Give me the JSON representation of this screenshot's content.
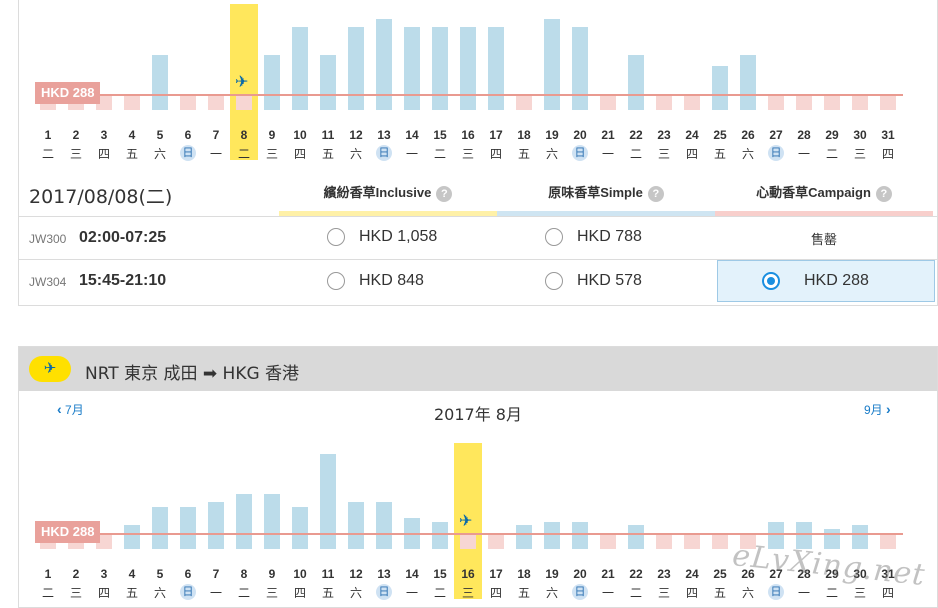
{
  "colors": {
    "bar": "#bcdcea",
    "bar_dim": "#f7d6d3",
    "highlight": "#ffe75c",
    "ref_line": "#e99a90",
    "accent": "#1a8fe0",
    "inclusive": "#fff1a8",
    "simple": "#cfe5f2",
    "campaign": "#f8cfcc"
  },
  "panel1": {
    "price_tag": "HKD 288",
    "selected_day_index": 7,
    "days": [
      "1",
      "2",
      "3",
      "4",
      "5",
      "6",
      "7",
      "8",
      "9",
      "10",
      "11",
      "12",
      "13",
      "14",
      "15",
      "16",
      "17",
      "18",
      "19",
      "20",
      "21",
      "22",
      "23",
      "24",
      "25",
      "26",
      "27",
      "28",
      "29",
      "30",
      "31"
    ],
    "weekdays": [
      "二",
      "三",
      "四",
      "五",
      "六",
      "日",
      "一",
      "二",
      "三",
      "四",
      "五",
      "六",
      "日",
      "一",
      "二",
      "三",
      "四",
      "五",
      "六",
      "日",
      "一",
      "二",
      "三",
      "四",
      "五",
      "六",
      "日",
      "一",
      "二",
      "三",
      "四"
    ],
    "chart_data": {
      "type": "bar",
      "categories": [
        "1",
        "2",
        "3",
        "4",
        "5",
        "6",
        "7",
        "8",
        "9",
        "10",
        "11",
        "12",
        "13",
        "14",
        "15",
        "16",
        "17",
        "18",
        "19",
        "20",
        "21",
        "22",
        "23",
        "24",
        "25",
        "26",
        "27",
        "28",
        "29",
        "30",
        "31"
      ],
      "values": [
        288,
        288,
        288,
        288,
        578,
        288,
        288,
        288,
        578,
        788,
        578,
        788,
        848,
        788,
        788,
        788,
        788,
        288,
        848,
        788,
        288,
        578,
        288,
        288,
        498,
        578,
        288,
        288,
        288,
        288,
        288
      ],
      "highlight": "8",
      "reference_line": 288
    }
  },
  "fare_table": {
    "date": "2017/08/08(二)",
    "headers": [
      {
        "label": "繽紛香草Inclusive",
        "help": "?"
      },
      {
        "label": "原味香草Simple",
        "help": "?"
      },
      {
        "label": "心動香草Campaign",
        "help": "?"
      }
    ],
    "rows": [
      {
        "flight": "JW300",
        "time": "02:00-07:25",
        "inclusive": "HKD 1,058",
        "simple": "HKD 788",
        "campaign": "售罄"
      },
      {
        "flight": "JW304",
        "time": "15:45-21:10",
        "inclusive": "HKD 848",
        "simple": "HKD 578",
        "campaign": "HKD 288"
      }
    ]
  },
  "panel2": {
    "route": "NRT 東京 成田 ➡ HKG 香港",
    "plane_icon": "plane-icon",
    "prev_month": "7月",
    "next_month": "9月",
    "month_title": "2017年 8月",
    "price_tag": "HKD 288",
    "selected_day_index": 15,
    "days": [
      "1",
      "2",
      "3",
      "4",
      "5",
      "6",
      "7",
      "8",
      "9",
      "10",
      "11",
      "12",
      "13",
      "14",
      "15",
      "16",
      "17",
      "18",
      "19",
      "20",
      "21",
      "22",
      "23",
      "24",
      "25",
      "26",
      "27",
      "28",
      "29",
      "30",
      "31"
    ],
    "weekdays": [
      "二",
      "三",
      "四",
      "五",
      "六",
      "日",
      "一",
      "二",
      "三",
      "四",
      "五",
      "六",
      "日",
      "一",
      "二",
      "三",
      "四",
      "五",
      "六",
      "日",
      "一",
      "二",
      "三",
      "四",
      "五",
      "六",
      "日",
      "一",
      "二",
      "三",
      "四"
    ],
    "chart_data": {
      "type": "bar",
      "categories": [
        "1",
        "2",
        "3",
        "4",
        "5",
        "6",
        "7",
        "8",
        "9",
        "10",
        "11",
        "12",
        "13",
        "14",
        "15",
        "16",
        "17",
        "18",
        "19",
        "20",
        "21",
        "22",
        "23",
        "24",
        "25",
        "26",
        "27",
        "28",
        "29",
        "30",
        "31"
      ],
      "values": [
        288,
        288,
        288,
        348,
        478,
        478,
        518,
        578,
        578,
        478,
        878,
        518,
        518,
        398,
        368,
        288,
        288,
        348,
        368,
        368,
        288,
        348,
        288,
        288,
        288,
        288,
        368,
        368,
        318,
        348,
        288
      ],
      "highlight": "16",
      "reference_line": 288
    }
  },
  "watermark": "eLvXing.net"
}
